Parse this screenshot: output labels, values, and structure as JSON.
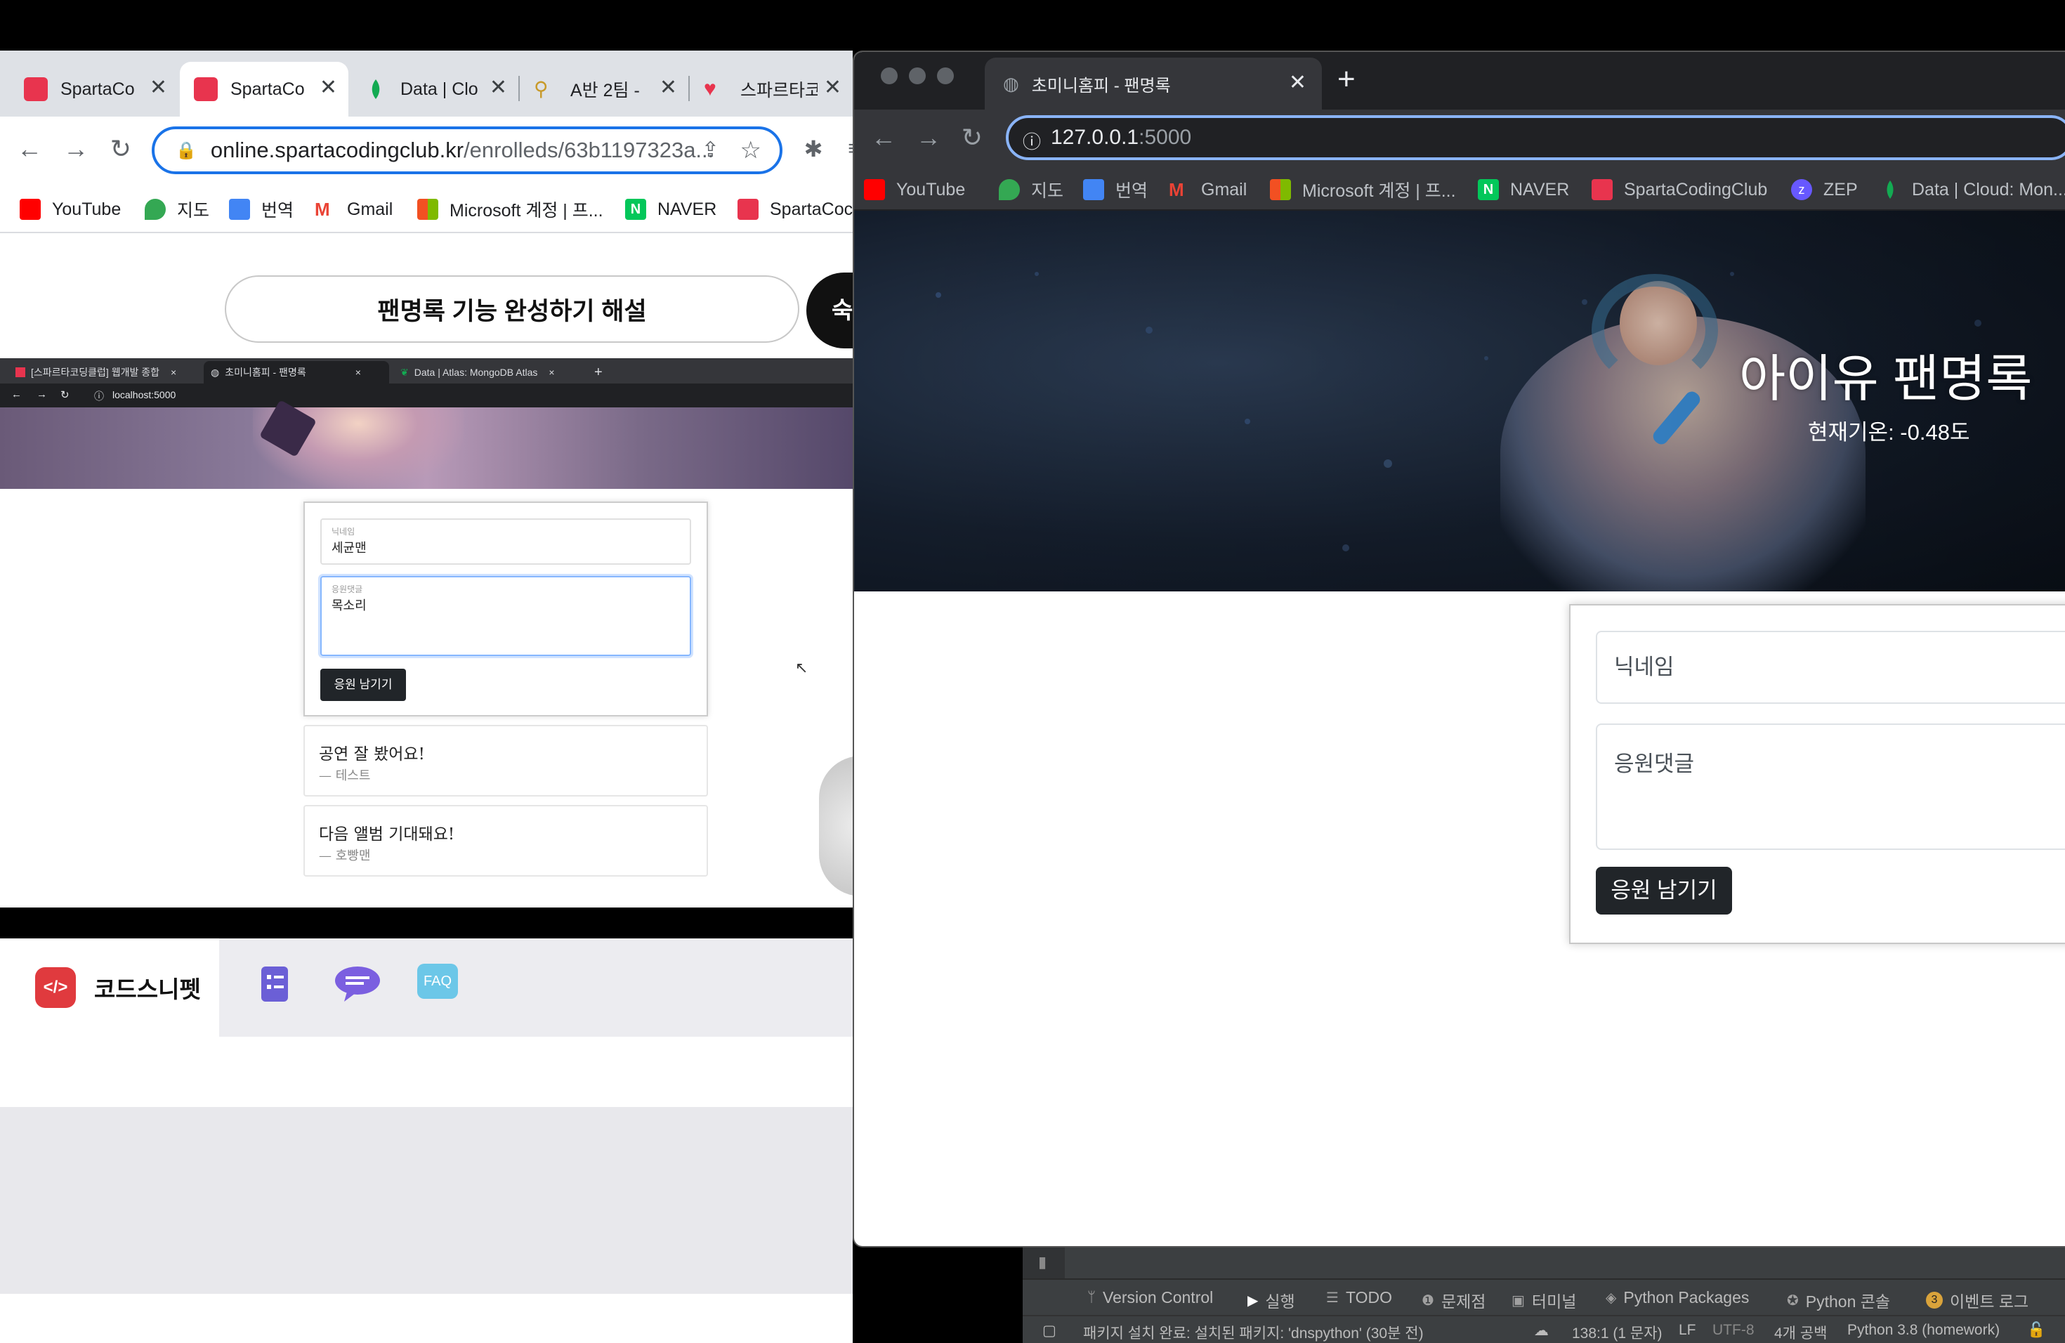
{
  "left_browser": {
    "tabs": [
      {
        "title": "SpartaCo",
        "active": false
      },
      {
        "title": "SpartaCo",
        "active": true
      },
      {
        "title": "Data | Clo",
        "active": false
      },
      {
        "title": "A반 2팀 -",
        "active": false
      },
      {
        "title": "스파르타코",
        "active": false
      }
    ],
    "url_host": "online.spartacodingclub.kr",
    "url_path": "/enrolleds/63b1197323a...",
    "bookmarks": [
      "YouTube",
      "지도",
      "번역",
      "Gmail",
      "Microsoft 계정 | 프...",
      "NAVER",
      "SpartaCoc"
    ],
    "lesson_title": "팬명록 기능 완성하기 해설",
    "next_label": "숙",
    "video": {
      "tabs": [
        "[스파르타코딩클럽] 웹개발 종합",
        "초미니홈피 - 팬명록",
        "Data | Atlas: MongoDB Atlas"
      ],
      "url": "localhost:5000",
      "nickname_label": "닉네임",
      "nickname_value": "세균맨",
      "comment_label": "응원댓글",
      "comment_value": "목소리",
      "button": "응원 남기기",
      "comments": [
        {
          "text": "공연 잘 봤어요!",
          "author": "— 테스트"
        },
        {
          "text": "다음 앨범 기대돼요!",
          "author": "— 호빵맨"
        }
      ]
    },
    "snippet": {
      "label": "코드스니펫",
      "logo": "</>",
      "faq": "FAQ"
    }
  },
  "right_browser": {
    "tab_title": "초미니홈피 - 팬명록",
    "url_host": "127.0.0.1",
    "url_port": ":5000",
    "bookmarks": [
      "YouTube",
      "지도",
      "번역",
      "Gmail",
      "Microsoft 계정 | 프...",
      "NAVER",
      "SpartaCodingClub",
      "ZEP",
      "Data | Cloud: Mon..."
    ],
    "hero_title": "아이유 팬명록",
    "hero_temp": "현재기온: -0.48도",
    "nickname_placeholder": "닉네임",
    "comment_placeholder": "응원댓글",
    "submit_button": "응원 남기기"
  },
  "ide": {
    "tools": [
      "Version Control",
      "실행",
      "TODO",
      "문제점",
      "터미널",
      "Python Packages",
      "Python 콘솔",
      "이벤트 로그"
    ],
    "event_count": "3",
    "status_message": "패키지 설치 완료: 설치된 패키지: 'dnspython' (30분 전)",
    "position": "138:1 (1 문자)",
    "line_ending": "LF",
    "encoding": "UTF-8",
    "indent": "4개 공백",
    "interpreter": "Python 3.8 (homework)"
  }
}
